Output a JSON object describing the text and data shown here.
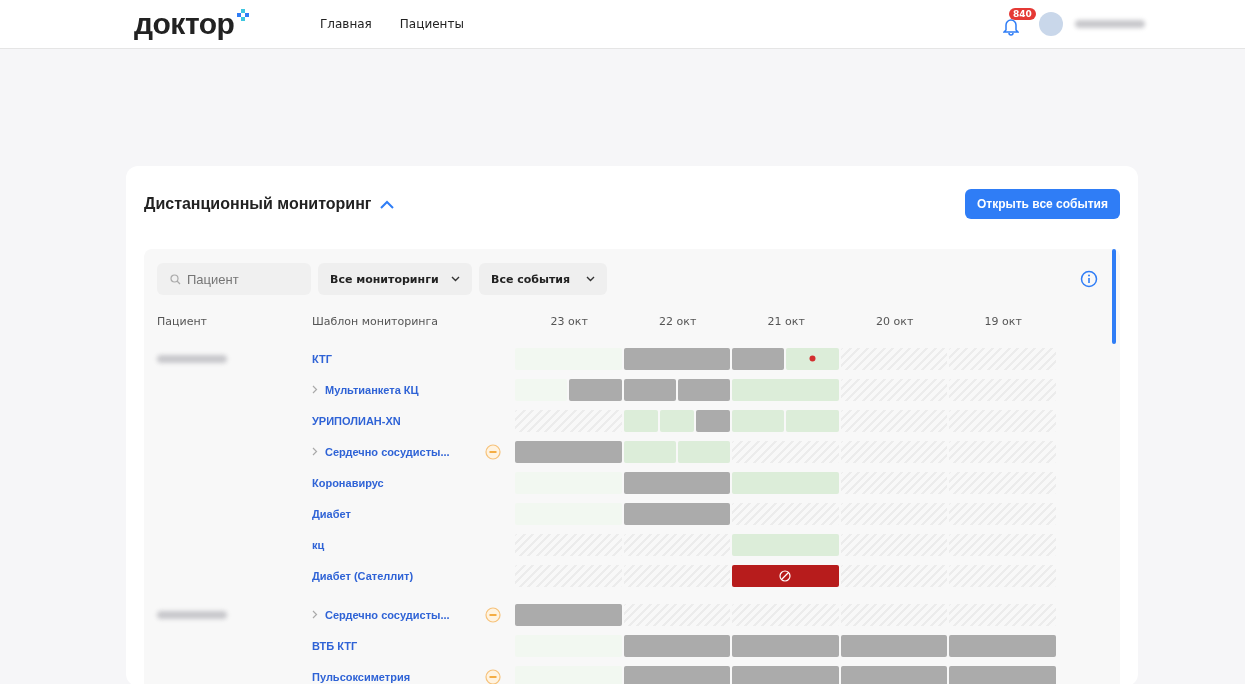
{
  "header": {
    "logo": "доктор",
    "nav": [
      {
        "label": "Главная",
        "selected": false
      },
      {
        "label": "Пациенты",
        "selected": false
      }
    ],
    "notifications_badge": "840"
  },
  "card": {
    "title": "Дистанционный мониторинг",
    "expanded": true,
    "action_button": "Открыть все события",
    "filters": {
      "search_placeholder": "Пациент",
      "dropdowns": [
        "Все мониторинги",
        "Все события"
      ]
    },
    "columns": {
      "patient": "Пациент",
      "template": "Шаблон мониторинга",
      "days": [
        "23 окт",
        "22 окт",
        "21 окт",
        "20 окт",
        "19 окт"
      ]
    },
    "groups": [
      {
        "rows": [
          {
            "template": "КТГ",
            "expandable": false,
            "warning": false,
            "days": [
              [
                {
                  "kind": "none"
                }
              ],
              [
                {
                  "kind": "done"
                }
              ],
              [
                {
                  "kind": "done"
                },
                {
                  "kind": "alert"
                }
              ],
              [
                {
                  "kind": "nodata"
                }
              ],
              [
                {
                  "kind": "nodata"
                }
              ]
            ]
          },
          {
            "template": "Мультианкета КЦ",
            "expandable": true,
            "warning": false,
            "days": [
              [
                {
                  "kind": "none"
                },
                {
                  "kind": "done"
                }
              ],
              [
                {
                  "kind": "done"
                },
                {
                  "kind": "done"
                }
              ],
              [
                {
                  "kind": "ok"
                }
              ],
              [
                {
                  "kind": "nodata"
                }
              ],
              [
                {
                  "kind": "nodata"
                }
              ]
            ]
          },
          {
            "template": "УРИПОЛИАН-XN",
            "expandable": false,
            "warning": false,
            "days": [
              [
                {
                  "kind": "nodata"
                }
              ],
              [
                {
                  "kind": "ok"
                },
                {
                  "kind": "ok"
                },
                {
                  "kind": "done"
                }
              ],
              [
                {
                  "kind": "ok"
                },
                {
                  "kind": "ok"
                }
              ],
              [
                {
                  "kind": "nodata"
                }
              ],
              [
                {
                  "kind": "nodata"
                }
              ]
            ]
          },
          {
            "template": "Сердечно сосудисты...",
            "expandable": true,
            "warning": true,
            "days": [
              [
                {
                  "kind": "done"
                }
              ],
              [
                {
                  "kind": "ok"
                },
                {
                  "kind": "ok"
                }
              ],
              [
                {
                  "kind": "nodata"
                }
              ],
              [
                {
                  "kind": "nodata"
                }
              ],
              [
                {
                  "kind": "nodata"
                }
              ]
            ]
          },
          {
            "template": "Коронавирус",
            "expandable": false,
            "warning": false,
            "days": [
              [
                {
                  "kind": "none"
                }
              ],
              [
                {
                  "kind": "done"
                }
              ],
              [
                {
                  "kind": "ok"
                }
              ],
              [
                {
                  "kind": "nodata"
                }
              ],
              [
                {
                  "kind": "nodata"
                }
              ]
            ]
          },
          {
            "template": "Диабет",
            "expandable": false,
            "warning": false,
            "days": [
              [
                {
                  "kind": "none"
                }
              ],
              [
                {
                  "kind": "done"
                }
              ],
              [
                {
                  "kind": "nodata"
                }
              ],
              [
                {
                  "kind": "nodata"
                }
              ],
              [
                {
                  "kind": "nodata"
                }
              ]
            ]
          },
          {
            "template": "кц",
            "expandable": false,
            "warning": false,
            "days": [
              [
                {
                  "kind": "nodata"
                }
              ],
              [
                {
                  "kind": "nodata"
                }
              ],
              [
                {
                  "kind": "ok"
                }
              ],
              [
                {
                  "kind": "nodata"
                }
              ],
              [
                {
                  "kind": "nodata"
                }
              ]
            ]
          },
          {
            "template": "Диабет (Сателлит)",
            "expandable": false,
            "warning": false,
            "days": [
              [
                {
                  "kind": "nodata"
                }
              ],
              [
                {
                  "kind": "nodata"
                }
              ],
              [
                {
                  "kind": "missed"
                }
              ],
              [
                {
                  "kind": "nodata"
                }
              ],
              [
                {
                  "kind": "nodata"
                }
              ]
            ]
          }
        ]
      },
      {
        "rows": [
          {
            "template": "Сердечно сосудисты...",
            "expandable": true,
            "warning": true,
            "days": [
              [
                {
                  "kind": "done"
                }
              ],
              [
                {
                  "kind": "nodata"
                }
              ],
              [
                {
                  "kind": "nodata"
                }
              ],
              [
                {
                  "kind": "nodata"
                }
              ],
              [
                {
                  "kind": "nodata"
                }
              ]
            ]
          },
          {
            "template": "ВТБ КТГ",
            "expandable": false,
            "warning": false,
            "days": [
              [
                {
                  "kind": "none"
                }
              ],
              [
                {
                  "kind": "done"
                }
              ],
              [
                {
                  "kind": "done"
                }
              ],
              [
                {
                  "kind": "done"
                }
              ],
              [
                {
                  "kind": "done"
                }
              ]
            ]
          },
          {
            "template": "Пульсоксиметрия",
            "expandable": false,
            "warning": true,
            "days": [
              [
                {
                  "kind": "none"
                }
              ],
              [
                {
                  "kind": "done"
                }
              ],
              [
                {
                  "kind": "done"
                }
              ],
              [
                {
                  "kind": "done"
                }
              ],
              [
                {
                  "kind": "done"
                }
              ]
            ]
          }
        ]
      }
    ]
  }
}
